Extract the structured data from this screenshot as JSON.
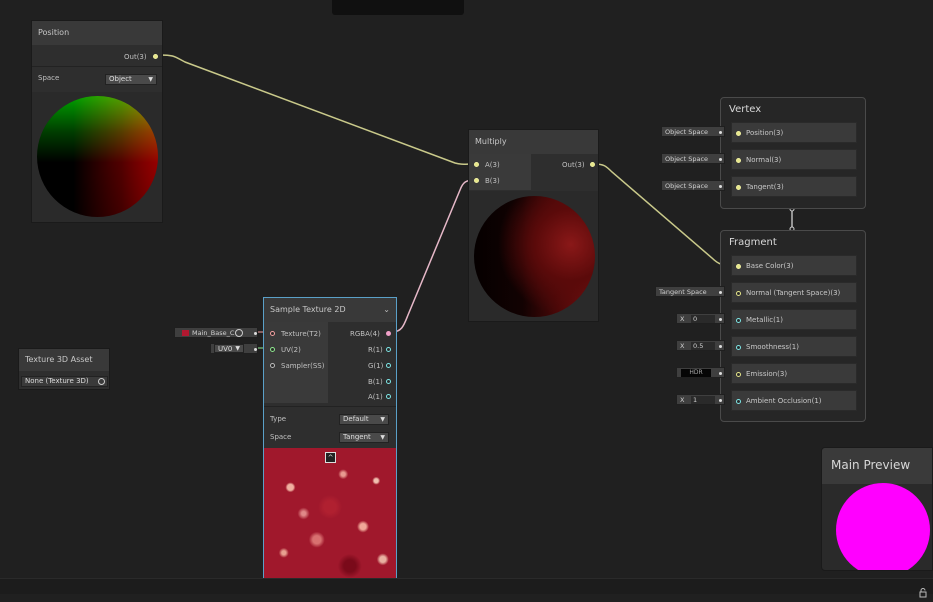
{
  "position_node": {
    "title": "Position",
    "out_label": "Out(3)",
    "space_label": "Space",
    "space_value": "Object"
  },
  "multiply_node": {
    "title": "Multiply",
    "in_a": "A(3)",
    "in_b": "B(3)",
    "out_label": "Out(3)"
  },
  "sample_node": {
    "title": "Sample Texture 2D",
    "in_texture": "Texture(T2)",
    "in_uv": "UV(2)",
    "in_sampler": "Sampler(SS)",
    "out_rgba": "RGBA(4)",
    "out_r": "R(1)",
    "out_g": "G(1)",
    "out_b": "B(1)",
    "out_a": "A(1)",
    "type_label": "Type",
    "type_value": "Default",
    "space_label": "Space",
    "space_value": "Tangent",
    "texture_input": "Main_Base_C",
    "uv_input": "UV0"
  },
  "texture3d_node": {
    "title": "Texture 3D Asset",
    "value": "None (Texture 3D)"
  },
  "vertex": {
    "title": "Vertex",
    "slots": [
      {
        "label": "Position(3)",
        "chip": "Object Space"
      },
      {
        "label": "Normal(3)",
        "chip": "Object Space"
      },
      {
        "label": "Tangent(3)",
        "chip": "Object Space"
      }
    ]
  },
  "fragment": {
    "title": "Fragment",
    "slots": [
      {
        "label": "Base Color(3)",
        "chip": ""
      },
      {
        "label": "Normal (Tangent Space)(3)",
        "chip": "Tangent Space"
      },
      {
        "label": "Metallic(1)",
        "chip_x": "X",
        "chip": "0"
      },
      {
        "label": "Smoothness(1)",
        "chip_x": "X",
        "chip": "0.5"
      },
      {
        "label": "Emission(3)",
        "chip": "HDR"
      },
      {
        "label": "Ambient Occlusion(1)",
        "chip_x": "X",
        "chip": "1"
      }
    ]
  },
  "main_preview": {
    "title": "Main Preview"
  },
  "colors": {
    "background": "#202020",
    "edge_yellow": "#c9c98a",
    "edge_pink": "#e6b8c8",
    "preview_magenta": "#ff00ff"
  }
}
